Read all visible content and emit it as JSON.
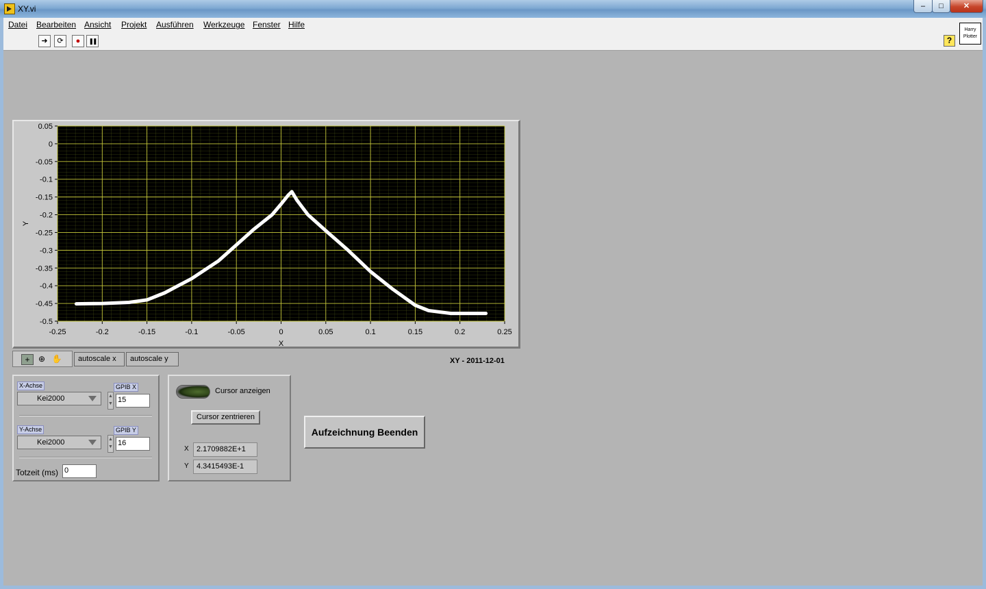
{
  "window": {
    "title": "XY.vi",
    "minimize": "–",
    "maximize": "□",
    "close": "✕"
  },
  "menu": [
    "Datei",
    "Bearbeiten",
    "Ansicht",
    "Projekt",
    "Ausführen",
    "Werkzeuge",
    "Fenster",
    "Hilfe"
  ],
  "toolbar": {
    "run": "➜",
    "run_continuously": "⟳",
    "abort": "●",
    "pause": "❚❚",
    "help": "?"
  },
  "vi_icon": {
    "line1": "Harry",
    "line2": "Plotter"
  },
  "graph": {
    "caption": "XY - 2011-12-01",
    "autoscale_x": "autoscale x",
    "autoscale_y": "autoscale y",
    "palette_icons": [
      "crosshair-icon",
      "zoom-icon",
      "pan-hand-icon"
    ]
  },
  "chart_data": {
    "type": "line",
    "xlabel": "X",
    "ylabel": "Y",
    "xlim": [
      -0.25,
      0.25
    ],
    "ylim": [
      -0.5,
      0.05
    ],
    "x_ticks": [
      "-0.25",
      "-0.2",
      "-0.15",
      "-0.1",
      "-0.05",
      "0",
      "0.05",
      "0.1",
      "0.15",
      "0.2",
      "0.25"
    ],
    "y_ticks": [
      "0.05",
      "0",
      "-0.05",
      "-0.1",
      "-0.15",
      "-0.2",
      "-0.25",
      "-0.3",
      "-0.35",
      "-0.4",
      "-0.45",
      "-0.5"
    ],
    "grid": true,
    "background": "#000000",
    "grid_color": "#6f7d20",
    "line_color": "#ffffff",
    "series": [
      {
        "x": [
          -0.229,
          -0.2,
          -0.17,
          -0.15,
          -0.13,
          -0.1,
          -0.07,
          -0.05,
          -0.03,
          -0.01,
          0.0,
          0.008,
          0.012,
          0.018,
          0.03,
          0.05,
          0.075,
          0.1,
          0.125,
          0.15,
          0.165,
          0.19,
          0.229
        ],
        "y": [
          -0.451,
          -0.45,
          -0.447,
          -0.44,
          -0.42,
          -0.38,
          -0.33,
          -0.285,
          -0.24,
          -0.2,
          -0.17,
          -0.145,
          -0.135,
          -0.16,
          -0.2,
          -0.245,
          -0.3,
          -0.36,
          -0.41,
          -0.455,
          -0.47,
          -0.478,
          -0.478
        ]
      }
    ]
  },
  "axes_panel": {
    "x_label": "X-Achse",
    "x_device": "Kei2000",
    "gpib_x_label": "GPIB X",
    "gpib_x": "15",
    "y_label": "Y-Achse",
    "y_device": "Kei2000",
    "gpib_y_label": "GPIB Y",
    "gpib_y": "16",
    "deadtime_label": "Totzeit (ms)",
    "deadtime": "0"
  },
  "cursor_panel": {
    "show_label": "Cursor anzeigen",
    "center_button": "Cursor zentrieren",
    "x_label": "X",
    "x_value": "2.1709882E+1",
    "y_label": "Y",
    "y_value": "4.3415493E-1"
  },
  "stop_button": "Aufzeichnung Beenden"
}
